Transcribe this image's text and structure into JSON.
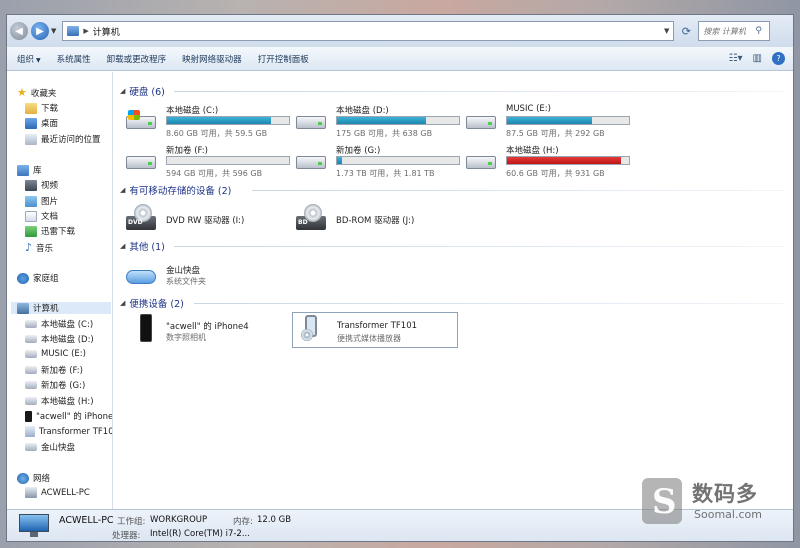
{
  "address": {
    "path": "计算机",
    "search_placeholder": "搜索 计算机"
  },
  "toolbar": {
    "items": [
      "组织",
      "系统属性",
      "卸载或更改程序",
      "映射网络驱动器",
      "打开控制面板"
    ]
  },
  "nav": {
    "favorites": {
      "label": "收藏夹",
      "items": [
        "下载",
        "桌面",
        "最近访问的位置"
      ]
    },
    "libraries": {
      "label": "库",
      "items": [
        "视频",
        "图片",
        "文档",
        "迅雷下载",
        "音乐"
      ]
    },
    "homegroup": "家庭组",
    "computer": {
      "label": "计算机",
      "items": [
        "本地磁盘 (C:)",
        "本地磁盘 (D:)",
        "MUSIC (E:)",
        "新加卷 (F:)",
        "新加卷 (G:)",
        "本地磁盘 (H:)",
        "\"acwell\" 的 iPhone4",
        "Transformer TF101",
        "金山快盘"
      ]
    },
    "network": {
      "label": "网络",
      "items": [
        "ACWELL-PC"
      ]
    }
  },
  "groups": {
    "hdd": {
      "title": "硬盘 (6)"
    },
    "removable": {
      "title": "有可移动存储的设备 (2)"
    },
    "other": {
      "title": "其他 (1)"
    },
    "portable": {
      "title": "便携设备 (2)"
    }
  },
  "drives": [
    {
      "name": "本地磁盘 (C:)",
      "sub": "8.60 GB 可用，共 59.5 GB",
      "used": 0.855,
      "system": true
    },
    {
      "name": "本地磁盘 (D:)",
      "sub": "175 GB 可用，共 638 GB",
      "used": 0.726
    },
    {
      "name": "MUSIC (E:)",
      "sub": "87.5 GB 可用，共 292 GB",
      "used": 0.7
    },
    {
      "name": "新加卷 (F:)",
      "sub": "594 GB 可用，共 596 GB",
      "used": 0.004
    },
    {
      "name": "新加卷 (G:)",
      "sub": "1.73 TB 可用，共 1.81 TB",
      "used": 0.044
    },
    {
      "name": "本地磁盘 (H:)",
      "sub": "60.6 GB 可用，共 931 GB",
      "used": 0.935,
      "full": true
    }
  ],
  "removable": [
    {
      "name": "DVD RW 驱动器 (I:)",
      "badge": "DVD"
    },
    {
      "name": "BD-ROM 驱动器 (J:)",
      "badge": "BD"
    }
  ],
  "other": [
    {
      "name": "金山快盘",
      "sub": "系统文件夹"
    }
  ],
  "portable": [
    {
      "name": "\"acwell\" 的 iPhone4",
      "sub": "数字照相机"
    },
    {
      "name": "Transformer TF101",
      "sub": "便携式媒体播放器"
    }
  ],
  "details": {
    "name": "ACWELL-PC",
    "workgroup_label": "工作组:",
    "workgroup": "WORKGROUP",
    "memory_label": "内存:",
    "memory": "12.0 GB",
    "cpu_label": "处理器:",
    "cpu": "Intel(R) Core(TM) i7-2..."
  },
  "watermark": {
    "brand": "数码多",
    "url": "Soomal.com"
  },
  "colors": {
    "bar": "#1c87ad",
    "bar_full": "#c11515",
    "header": "#1e3287"
  }
}
